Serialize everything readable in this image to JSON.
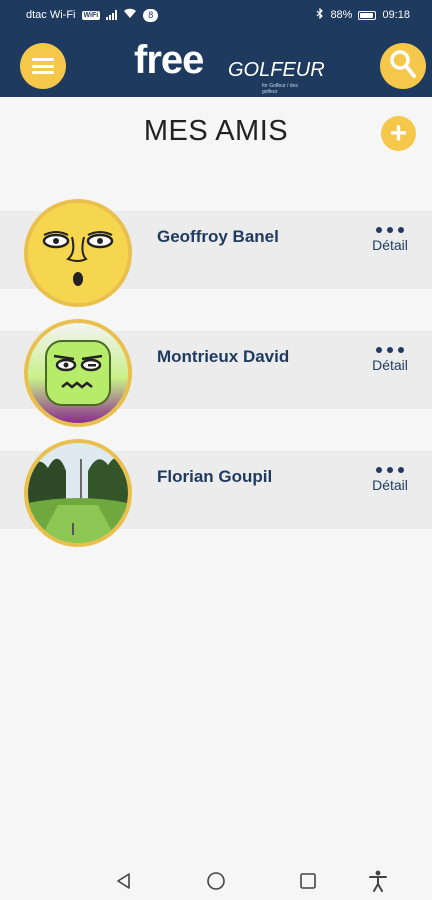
{
  "status_bar": {
    "carrier": "dtac Wi-Fi",
    "wifi_badge": "WiFi",
    "notification_count": "8",
    "battery": "88%",
    "time": "09:18"
  },
  "header": {
    "logo_main": "free",
    "logo_sub": "GOLFEUR",
    "logo_tagline": "for Golfeur / des golfeur",
    "menu_icon": "hamburger-icon",
    "search_icon": "search-icon"
  },
  "page": {
    "title": "MES AMIS",
    "add_symbol": "+"
  },
  "friends": [
    {
      "name": "Geoffroy Banel",
      "detail_label": "Détail",
      "avatar": "emoji-face-avatar"
    },
    {
      "name": "Montrieux David",
      "detail_label": "Détail",
      "avatar": "green-face-avatar"
    },
    {
      "name": "Florian Goupil",
      "detail_label": "Détail",
      "avatar": "golf-course-avatar"
    }
  ],
  "colors": {
    "header_bg": "#1f3a5f",
    "accent_yellow": "#f5c84c",
    "name_blue": "#1f3a5f",
    "page_bg": "#f6f6f6",
    "row_bg": "#ececec"
  }
}
